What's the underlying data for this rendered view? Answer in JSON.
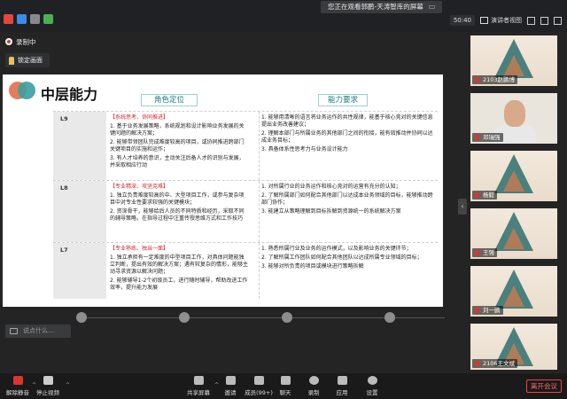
{
  "topbar": {
    "sharing_banner": "您正在观看郭鹏-天涛智库的屏幕",
    "timer": "50:40",
    "speaker_view": "演讲者视图"
  },
  "recording": {
    "label": "录制中"
  },
  "lock_screen": {
    "label": "锁定画面"
  },
  "slide": {
    "title": "中层能力",
    "col_role": "角色定位",
    "col_req": "能力要求",
    "rows": [
      {
        "level": "L9",
        "role": [
          {
            "text": "【系统思考、协同推进】",
            "red": true
          },
          {
            "text": "1. 基于业务发展策略，系统规划和设计影响业务发展的关键问题的解决方案；",
            "red": false
          },
          {
            "text": "2. 能够带领团队完成难度较高的项目，或协同推进跨部门关键项目的实施和运作；",
            "red": false
          },
          {
            "text": "3. 有人才培养的意识，主动关注后备人才的识别与发展，并采取相应行动",
            "red": false
          }
        ],
        "req": [
          {
            "text": "1. 能够用清晰的语言将业务运作的共性规律，能基于核心竞对的关键信息提出业务改善建议；",
            "red": false
          },
          {
            "text": "2. 理解本部门与所属业务的其他部门之间的衔接，能有效推动并协同以达成业务目标；",
            "red": false
          },
          {
            "text": "3. 具备体系性思考力与业务设计能力",
            "red": false
          }
        ]
      },
      {
        "level": "L8",
        "role": [
          {
            "text": "【专业精深、攻坚克难】",
            "red": true
          },
          {
            "text": "1. 独立负责难度较高的中、大型项目工作，或参与复杂项目中对专业性要求较强的关键模块；",
            "red": false
          },
          {
            "text": "2. 资深骨干，能够给后人员的不同特质和经历，采取不同的辅导策略，在指导过程中注重传授思维方式和工作技巧",
            "red": false
          }
        ],
        "req": [
          {
            "text": "1. 对所属行业的业务运作和核心竞对的运营有充分的认知；",
            "red": false
          },
          {
            "text": "2. 了解所属部门如何配合其他部门以达成本业务领域的目标，能够推动跨部门协作；",
            "red": false
          },
          {
            "text": "3. 能建立从策略理解到目标拆解到资源统一的系统解决方案",
            "red": false
          }
        ]
      },
      {
        "level": "L7",
        "role": [
          {
            "text": "【专业熟练、独当一面】",
            "red": true
          },
          {
            "text": "1. 独立承担有一定难度的中型项目工作，对具体问题能独立判断，提出有效的解决方案；遇有较复杂的情形，能够主动寻求资源以解决问题；",
            "red": false
          },
          {
            "text": "2. 能够辅导1-2个初级员工，进行随时辅导，帮助改进工作效率，提升能力发展",
            "red": false
          }
        ],
        "req": [
          {
            "text": "1. 熟悉所属行业及业务的运作模式，以及影响业务的关键环节；",
            "red": false
          },
          {
            "text": "2. 了解所属工作团队如何配合其他团队以达成所属专业领域的目标；",
            "red": false
          },
          {
            "text": "3. 能够对所负责的项目或模块进行策略拆解",
            "red": false
          }
        ]
      }
    ]
  },
  "chat": {
    "placeholder": "说点什么..."
  },
  "participants": [
    {
      "name": "2103赵鹏博"
    },
    {
      "name": "邓瑞强"
    },
    {
      "name": "杨毅"
    },
    {
      "name": "王强"
    },
    {
      "name": "刘一鹏"
    },
    {
      "name": "2106王文斌"
    }
  ],
  "toolbar": {
    "mute": "解除静音",
    "stop_video": "停止视频",
    "share_screen": "共享屏幕",
    "invite": "邀请",
    "members": "成员(99+)",
    "chat": "聊天",
    "record": "录制",
    "apps": "应用",
    "settings": "设置",
    "leave": "离开会议"
  },
  "colors": {
    "accent_red": "#d7262c",
    "teal": "#2d6f6d",
    "coral": "#e67d5a"
  }
}
